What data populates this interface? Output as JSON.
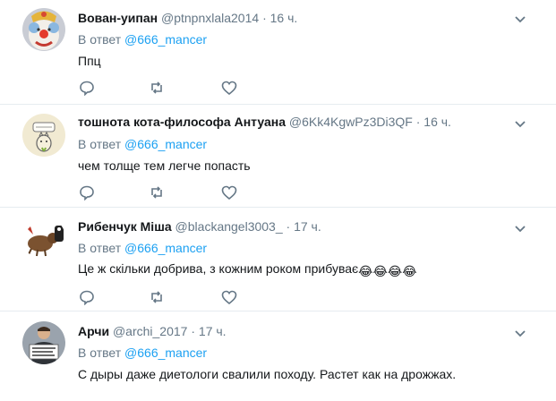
{
  "reply_prefix": "В ответ",
  "tweets": [
    {
      "name": "Вован-уипан",
      "handle": "@ptnpnxlala2014",
      "dot": "·",
      "time": "16 ч.",
      "reply_to": "@666_mancer",
      "text": "Ппц",
      "avatar_icon": "clown-avatar"
    },
    {
      "name": "тошнота кота-философа Антуана",
      "handle": "@6Kk4KgwPz3Di3QF",
      "dot": "·",
      "time": "16 ч.",
      "reply_to": "@666_mancer",
      "text": "чем толще тем легче попасть",
      "avatar_icon": "sketch-avatar"
    },
    {
      "name": "Рибенчук Міша",
      "handle": "@blackangel3003_",
      "dot": "·",
      "time": "17 ч.",
      "reply_to": "@666_mancer",
      "text": "Це ж скільки добрива, з кожним роком прибуває",
      "emojis": [
        "😂",
        "😂",
        "😂",
        "😂"
      ],
      "avatar_icon": "animal-avatar"
    },
    {
      "name": "Арчи",
      "handle": "@archi_2017",
      "dot": "·",
      "time": "17 ч.",
      "reply_to": "@666_mancer",
      "text": "С дыры даже диетологи свалили походу. Растет как на дрожжах.",
      "avatar_icon": "protest-avatar"
    }
  ],
  "colors": {
    "link": "#1da1f2",
    "secondary": "#657786",
    "divider": "#e6ecf0",
    "text": "#14171a"
  }
}
